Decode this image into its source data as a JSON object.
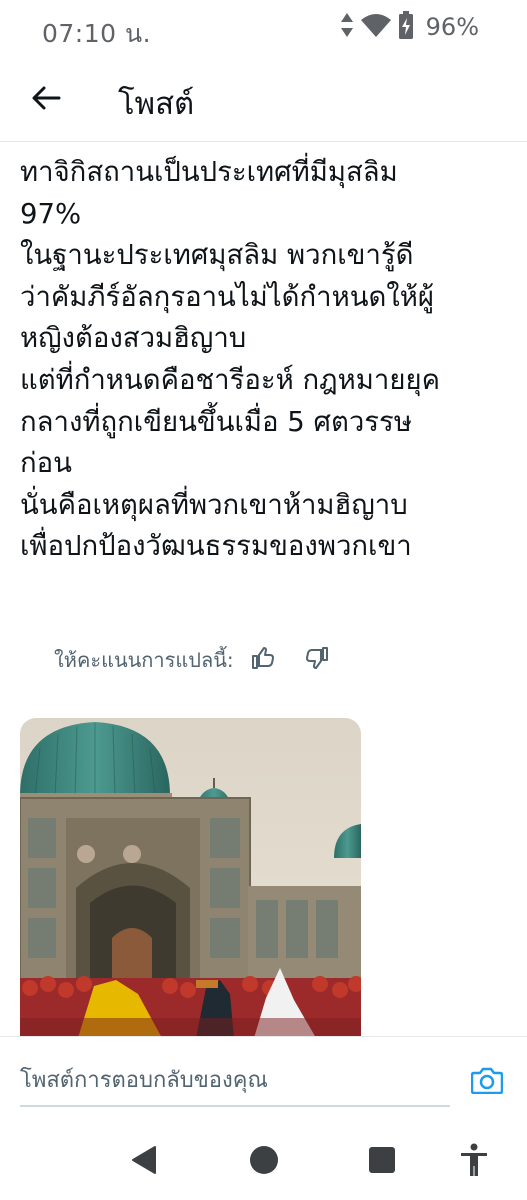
{
  "status_bar": {
    "time": "07:10 น.",
    "battery": "96%",
    "icons": [
      "data-arrows-icon",
      "wifi-icon",
      "battery-charging-icon"
    ]
  },
  "app_bar": {
    "back_icon": "arrow-left-icon",
    "title": "โพสต์"
  },
  "post": {
    "lines": [
      "ทาจิกิสถานเป็นประเทศที่มีมุสลิม",
      "97%",
      "ในฐานะประเทศมุสลิม พวกเขารู้ดี",
      "ว่าคัมภีร์อัลกุรอานไม่ได้กำหนดให้ผู้",
      "หญิงต้องสวมฮิญาบ",
      "แต่ที่กำหนดคือชารีอะห์ กฎหมายยุค",
      "กลางที่ถูกเขียนขึ้นเมื่อ 5 ศตวรรษ",
      "ก่อน",
      "นั่นคือเหตุผลที่พวกเขาห้ามฮิญาบ",
      "เพื่อปกป้องวัฒนธรรมของพวกเขา"
    ]
  },
  "translation_rating": {
    "label": "ให้คะแนนการแปลนี้:",
    "icons": [
      "thumbs-up-icon",
      "thumbs-down-icon"
    ]
  },
  "media": {
    "icon": "mosque-photo"
  },
  "compose": {
    "placeholder": "โพสต์การตอบกลับของคุณ",
    "camera_icon": "camera-icon"
  },
  "nav_bar": {
    "icons": [
      "back-triangle-icon",
      "home-circle-icon",
      "recents-square-icon",
      "accessibility-icon"
    ]
  },
  "colors": {
    "text": "#0f1419",
    "secondary": "#536471",
    "accent": "#1d9bf0"
  }
}
